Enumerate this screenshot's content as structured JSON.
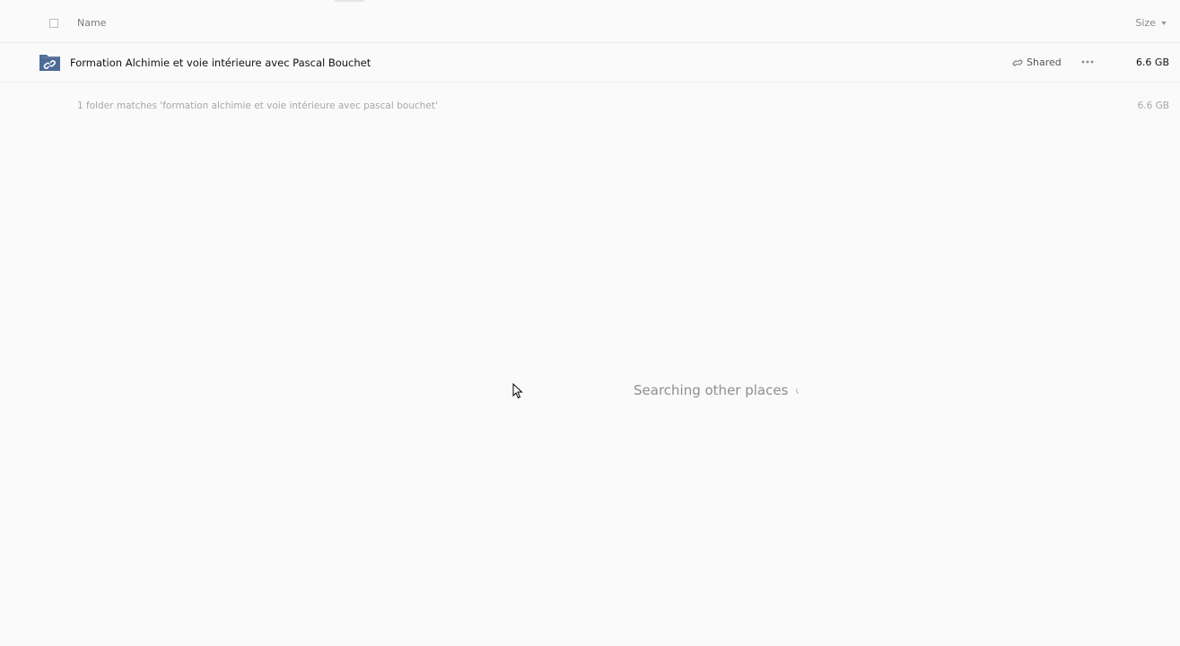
{
  "header": {
    "name_label": "Name",
    "size_label": "Size"
  },
  "rows": [
    {
      "name": "Formation Alchimie et voie intérieure avec Pascal Bouchet",
      "shared_label": "Shared",
      "size": "6.6 GB",
      "icon": "shared-folder-icon"
    }
  ],
  "summary": {
    "text": "1 folder matches 'formation alchimie et voie intérieure avec pascal bouchet'",
    "size": "6.6 GB"
  },
  "status": {
    "searching_text": "Searching other places"
  },
  "colors": {
    "folder_icon": "#4e6b96",
    "background": "#fafafa"
  }
}
